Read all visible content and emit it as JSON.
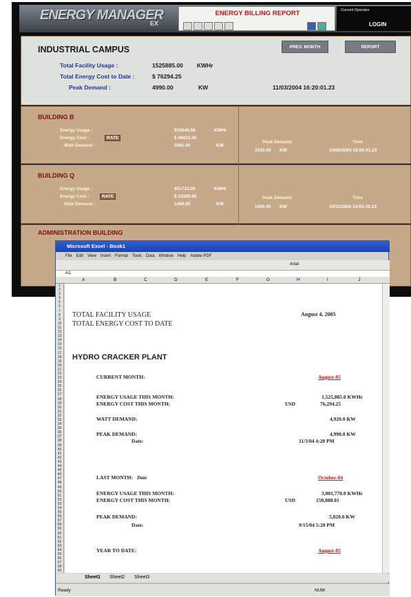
{
  "header": {
    "logo": "ENERGY MANAGER",
    "sub": "EX",
    "title": "ENERGY BILLING REPORT",
    "operator": "Current Operator",
    "login": "LOGIN"
  },
  "campus": {
    "title": "INDUSTRIAL CAMPUS",
    "prev": "PREV. MONTH",
    "report": "REPORT",
    "usage_label": "Total Facility Usage :",
    "usage": "1525885.00",
    "usage_unit": "KWHr",
    "cost_label": "Total Energy Cost to Date :",
    "cost": "$ 76294.25",
    "peak_label": "Peak Demand :",
    "peak": "4990.00",
    "peak_unit": "KW",
    "datetime": "11/03/2004 16:20:01.23"
  },
  "buildings": [
    {
      "name": "BUILDING B",
      "usage": "932649.00",
      "cost": "$ 46632.45",
      "watt": "2991.00",
      "peak": "3103.00",
      "time": "10/06/2004 15:00:01.23"
    },
    {
      "name": "BUILDING Q",
      "usage": "451713.00",
      "cost": "$ 22585.65",
      "watt": "1459.00",
      "peak": "1505.00",
      "time": "10/11/2004 14:05:20.23"
    }
  ],
  "labels": {
    "usage": "Energy Usage :",
    "cost": "Energy Cost :",
    "rate": "RATE",
    "watt": "Watt Demand :",
    "kwhr": "KWHr",
    "kw": "KW",
    "pd": "Peak Demand",
    "time": "Time",
    "admin": "ADMINISTRATION BUILDING"
  },
  "excel": {
    "title": "Microsoft Excel - Book1",
    "menu": [
      "File",
      "Edit",
      "View",
      "Insert",
      "Format",
      "Tools",
      "Data",
      "Window",
      "Help",
      "Adobe PDF"
    ],
    "cell": "A1",
    "font": "Arial",
    "cols": [
      "A",
      "B",
      "C",
      "D",
      "E",
      "F",
      "G",
      "H",
      "I",
      "J"
    ],
    "sheet": {
      "tfu": "TOTAL FACILITY USAGE",
      "tec": "TOTAL ENERGY COST TO DATE",
      "date": "August 4, 2005",
      "plant": "HYDRO CRACKER PLANT",
      "cm": "CURRENT MONTH:",
      "aug": "August-05",
      "eu": "ENERGY USAGE THIS MONTH:",
      "ec": "ENERGY COST THIS MONTH:",
      "usd": "USD",
      "v1": "1,525,885.0 KWHr",
      "v2": "76,294.25",
      "wd": "WATT DEMAND:",
      "v3": "4,920.0 KW",
      "pd": "PEAK DEMAND:",
      "v4": "4,990.0 KW",
      "dt": "Date:",
      "v5": "11/3/04 4:20 PM",
      "lm": "LAST MONTH:",
      "lmd": "Date",
      "oct": "October-04",
      "v6": "3,001,770.0 KWHr",
      "v7": "150,088.01",
      "v8": "5,020.6 KW",
      "v9": "9/15/04 5:20 PM",
      "ytd": "YEAR TO DATE:",
      "aug2": "August-05"
    },
    "tabs": [
      "Sheet1",
      "Sheet2",
      "Sheet3"
    ],
    "status": "Ready",
    "num": "NUM"
  }
}
